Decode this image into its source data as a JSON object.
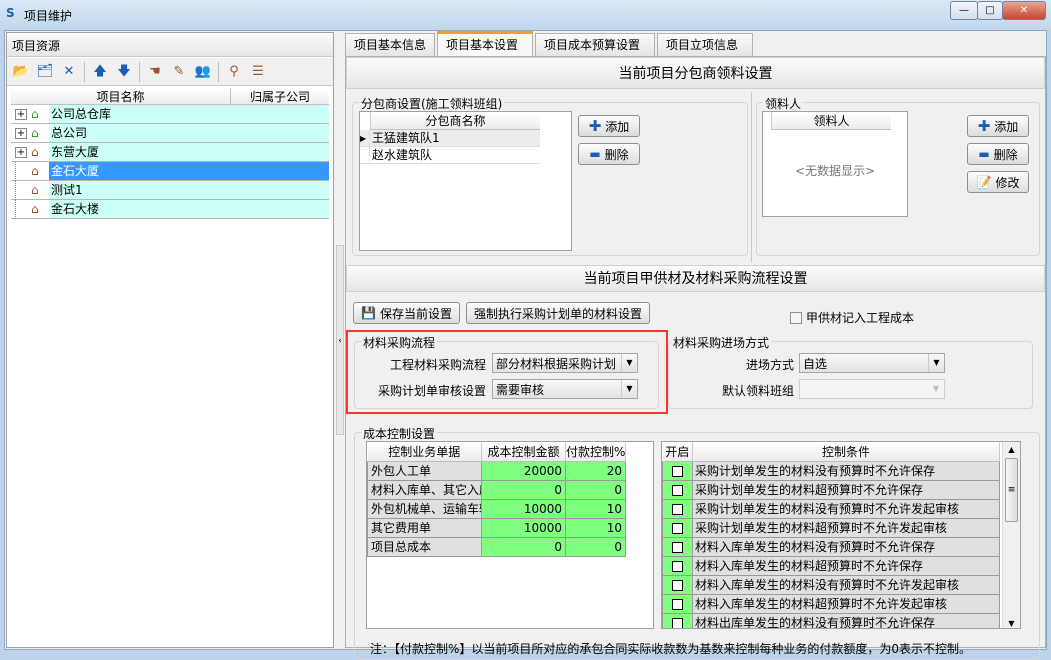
{
  "window": {
    "title": "项目维护",
    "controls": [
      "—",
      "□",
      "✕"
    ]
  },
  "left": {
    "header": "项目资源",
    "toolbar": [
      {
        "icon": "new-folder-icon",
        "glyph": "📂"
      },
      {
        "icon": "edit-folder-icon",
        "glyph": "🗂"
      },
      {
        "icon": "delete-icon",
        "glyph": "✕"
      },
      {
        "icon": "arrow-up-icon",
        "glyph": "🡅"
      },
      {
        "icon": "arrow-down-icon",
        "glyph": "🡇"
      },
      {
        "icon": "pointing-hand-icon",
        "glyph": "☚"
      },
      {
        "icon": "eraser-icon",
        "glyph": "✎"
      },
      {
        "icon": "users-icon",
        "glyph": "👥"
      },
      {
        "icon": "binoculars-icon",
        "glyph": "⚲"
      },
      {
        "icon": "list-icon",
        "glyph": "☰"
      }
    ],
    "columns": [
      "项目名称",
      "归属子公司"
    ],
    "tree": [
      {
        "label": "公司总仓库",
        "expandable": true,
        "icon": "warehouse-icon",
        "selected": false
      },
      {
        "label": "总公司",
        "expandable": true,
        "icon": "warehouse-icon",
        "selected": false
      },
      {
        "label": "东营大厦",
        "expandable": true,
        "icon": "house-icon",
        "selected": false
      },
      {
        "label": "金石大厦",
        "expandable": false,
        "icon": "house-icon",
        "selected": true
      },
      {
        "label": "测试1",
        "expandable": false,
        "icon": "house-icon",
        "selected": false
      },
      {
        "label": "金石大楼",
        "expandable": false,
        "icon": "house-icon",
        "selected": false
      }
    ]
  },
  "tabs": [
    {
      "label": "项目基本信息",
      "active": false
    },
    {
      "label": "项目基本设置",
      "active": true
    },
    {
      "label": "项目成本预算设置",
      "active": false
    },
    {
      "label": "项目立项信息",
      "active": false
    }
  ],
  "sub": {
    "title": "当前项目分包商领料设置",
    "group1": {
      "label": "分包商设置(施工领料班组)",
      "column": "分包商名称",
      "rows": [
        "王猛建筑队1",
        "赵水建筑队"
      ],
      "add": "添加",
      "remove": "删除"
    },
    "group2": {
      "label": "领料人",
      "column": "领料人",
      "empty": "<无数据显示>",
      "add": "添加",
      "remove": "删除",
      "edit": "修改"
    }
  },
  "proc": {
    "title": "当前项目甲供材及材料采购流程设置",
    "save": "保存当前设置",
    "force": "强制执行采购计划单的材料设置",
    "checkbox": {
      "label": "甲供材记入工程成本",
      "checked": false
    },
    "flow": {
      "label": "材料采购流程",
      "f1": "工程材料采购流程",
      "v1": "部分材料根据采购计划",
      "f2": "采购计划单审核设置",
      "v2": "需要审核"
    },
    "entry": {
      "label": "材料采购进场方式",
      "f1": "进场方式",
      "v1": "自选",
      "f2": "默认领料班组",
      "v2": ""
    }
  },
  "cost": {
    "label": "成本控制设置",
    "columns": [
      "控制业务单据",
      "成本控制金额",
      "付款控制%"
    ],
    "rows": [
      [
        "外包人工单",
        "20000",
        "20"
      ],
      [
        "材料入库单、其它入库单",
        "0",
        "0"
      ],
      [
        "外包机械单、运输车辆单",
        "10000",
        "10"
      ],
      [
        "其它费用单",
        "10000",
        "10"
      ],
      [
        "项目总成本",
        "0",
        "0"
      ]
    ],
    "cond_columns": [
      "开启",
      "控制条件"
    ],
    "conditions": [
      {
        "checked": false,
        "text": "采购计划单发生的材料没有预算时不允许保存"
      },
      {
        "checked": false,
        "text": "采购计划单发生的材料超预算时不允许保存"
      },
      {
        "checked": false,
        "text": "采购计划单发生的材料没有预算时不允许发起审核"
      },
      {
        "checked": false,
        "text": "采购计划单发生的材料超预算时不允许发起审核"
      },
      {
        "checked": false,
        "text": "材料入库单发生的材料没有预算时不允许保存"
      },
      {
        "checked": false,
        "text": "材料入库单发生的材料超预算时不允许保存"
      },
      {
        "checked": false,
        "text": "材料入库单发生的材料没有预算时不允许发起审核"
      },
      {
        "checked": false,
        "text": "材料入库单发生的材料超预算时不允许发起审核"
      },
      {
        "checked": false,
        "text": "材料出库单发生的材料没有预算时不允许保存"
      }
    ],
    "note": "注：【付款控制%】以当前项目所对应的承包合同实际收款数为基数来控制每种业务的付款额度，为0表示不控制。"
  },
  "colors": {
    "selected": "#3399ff",
    "row": "#ccfff5",
    "green": "#80ff80",
    "highlight": "#ff3333"
  }
}
